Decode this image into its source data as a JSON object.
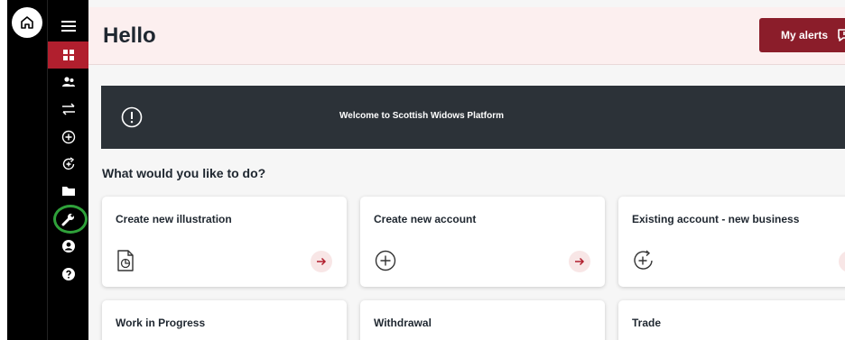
{
  "header": {
    "greeting": "Hello",
    "alerts_label": "My alerts"
  },
  "banner": {
    "message": "Welcome to Scottish Widows Platform"
  },
  "actions": {
    "title": "What would you like to do?",
    "cards": [
      {
        "label": "Create new illustration",
        "icon": "document-chart-icon"
      },
      {
        "label": "Create new account",
        "icon": "plus-circle-icon"
      },
      {
        "label": "Existing account - new business",
        "icon": "circular-plus-arrow-icon"
      },
      {
        "label": "Work in Progress"
      },
      {
        "label": "Withdrawal"
      },
      {
        "label": "Trade"
      }
    ]
  },
  "nav": {
    "icons": [
      "home-icon",
      "menu-icon",
      "dashboard-icon",
      "users-icon",
      "transfer-icon",
      "add-icon",
      "top-up-icon",
      "folder-icon",
      "wrench-icon",
      "user-icon",
      "help-icon"
    ],
    "active": "dashboard-icon",
    "highlighted": "wrench-icon"
  },
  "colors": {
    "brand": "#8b1d2a",
    "accent": "#b11f2e",
    "banner": "#2c3238",
    "highlight_ring": "#2fa13a"
  }
}
